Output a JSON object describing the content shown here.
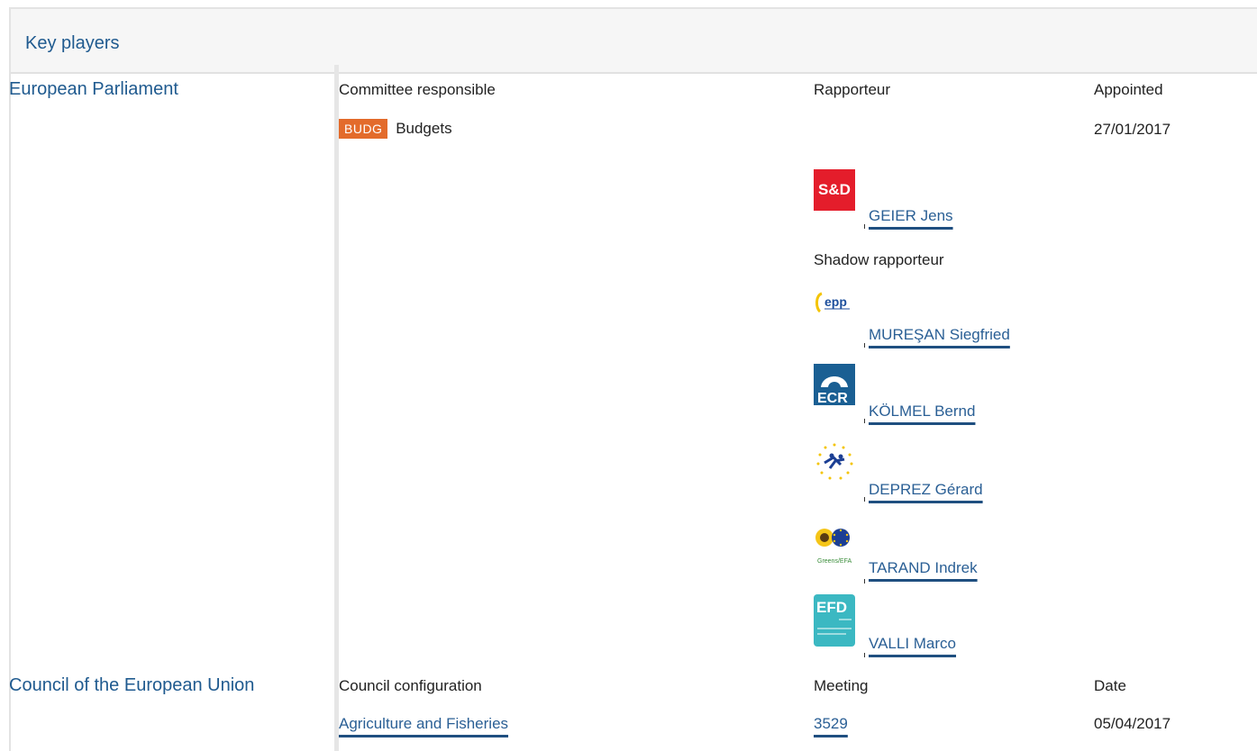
{
  "header": {
    "title": "Key players"
  },
  "ep": {
    "institution": "European Parliament",
    "col_committee": "Committee responsible",
    "col_rapporteur": "Rapporteur",
    "col_appointed": "Appointed",
    "committee_code": "BUDG",
    "committee_name": "Budgets",
    "appointed_date": "27/01/2017",
    "rapporteur": {
      "group_logo": "S&D",
      "name": "GEIER Jens"
    },
    "shadow_label": "Shadow rapporteur",
    "shadows": [
      {
        "group_logo": "epp",
        "name": "MUREŞAN Siegfried"
      },
      {
        "group_logo": "ECR",
        "name": "KÖLMEL Bernd"
      },
      {
        "group_logo": "ALDE",
        "name": "DEPREZ Gérard"
      },
      {
        "group_logo": "Greens/EFA",
        "name": "TARAND Indrek"
      },
      {
        "group_logo": "EFD",
        "name": "VALLI Marco"
      }
    ]
  },
  "council": {
    "institution": "Council of the European Union",
    "col_config": "Council configuration",
    "col_meeting": "Meeting",
    "col_date": "Date",
    "config": "Agriculture and Fisheries",
    "meeting": "3529",
    "date": "05/04/2017"
  },
  "colors": {
    "link": "#2a5f95",
    "heading": "#1f5a8f",
    "badge": "#e36b2b"
  }
}
